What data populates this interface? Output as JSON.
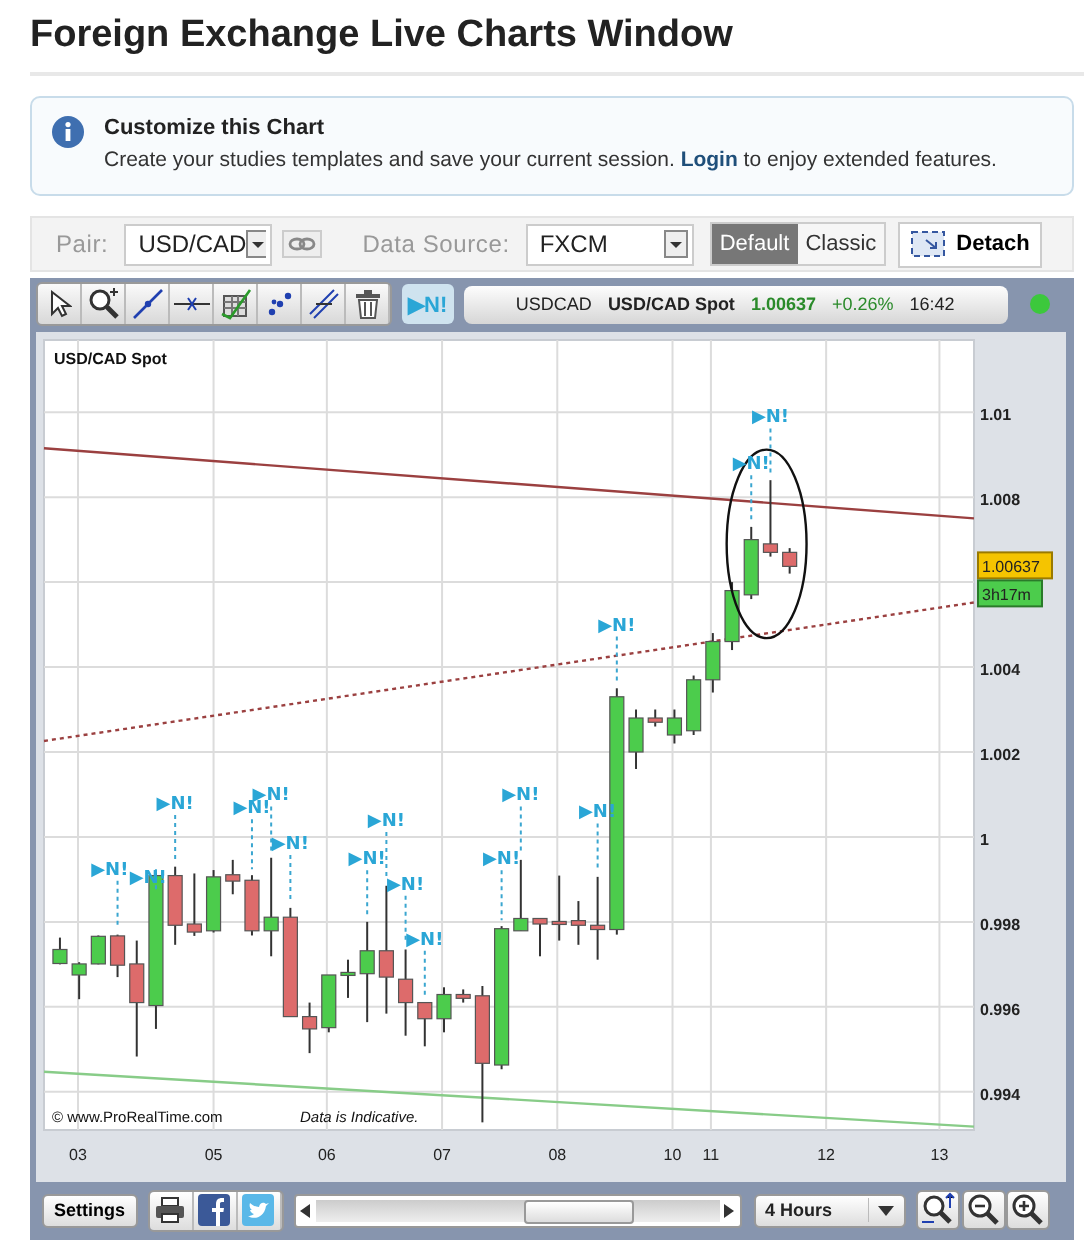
{
  "page": {
    "title": "Foreign Exchange Live Charts Window"
  },
  "notice": {
    "title": "Customize this Chart",
    "text_before": "Create your studies templates and save your current session.",
    "link": "Login",
    "text_after": "to enjoy extended features."
  },
  "controls": {
    "pair_label": "Pair:",
    "pair": "USD/CAD",
    "source_label": "Data Source:",
    "source": "FXCM",
    "styles": [
      {
        "label": "Default",
        "selected": true
      },
      {
        "label": "Classic",
        "selected": false
      }
    ],
    "detach": "Detach"
  },
  "chart_toolbar": {
    "news_button": "▶N!",
    "ticker": {
      "symbol": "USDCAD",
      "name": "USD/CAD Spot",
      "price": "1.00637",
      "change": "+0.26%",
      "time": "16:42"
    },
    "connected": true
  },
  "chart": {
    "title": "USD/CAD Spot",
    "price_tag": "1.00637",
    "time_tag": "3h17m",
    "footer_source": "© www.ProRealTime.com",
    "footer_note": "Data is Indicative.",
    "y_axis_labels": [
      "1.01",
      "1.008",
      "1.004",
      "1.002",
      "1",
      "0.998",
      "0.996",
      "0.994"
    ],
    "x_axis_labels": [
      "03",
      "05",
      "06",
      "07",
      "08",
      "10",
      "11",
      "12",
      "13"
    ],
    "news_markers": [
      "▶N!",
      "▶N!",
      "▶N!",
      "▶N!",
      "▶N!",
      "▶N!",
      "▶N!",
      "▶N!",
      "▶N!",
      "▶N!",
      "▶N!",
      "▶N!",
      "▶N!",
      "▶N!",
      "▶N!",
      "▶N!"
    ]
  },
  "bottom_bar": {
    "settings": "Settings",
    "timeframe": "4 Hours"
  }
}
